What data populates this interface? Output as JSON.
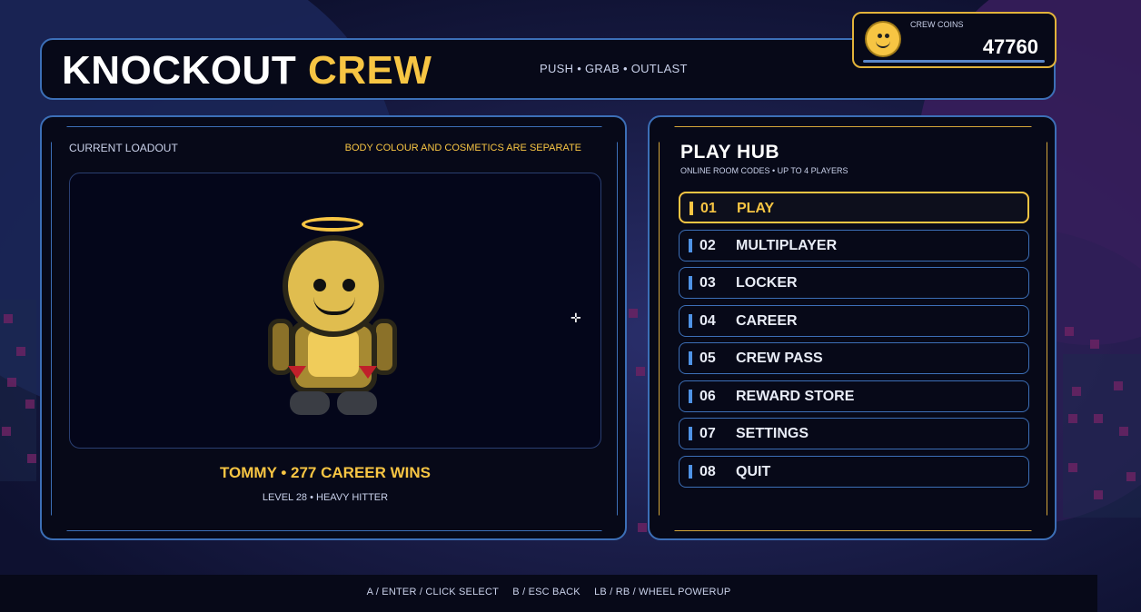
{
  "header": {
    "title_white": "KNOCKOUT",
    "title_yellow": "CREW",
    "tagline": "PUSH • GRAB • OUTLAST"
  },
  "coins": {
    "label": "CREW COINS",
    "value": "47760"
  },
  "loadout": {
    "label": "CURRENT LOADOUT",
    "note": "BODY COLOUR AND COSMETICS ARE SEPARATE",
    "player_line": "TOMMY  •  277 CAREER WINS",
    "player_sub": "LEVEL 28  •  HEAVY HITTER"
  },
  "hub": {
    "title": "PLAY HUB",
    "subtitle": "ONLINE ROOM CODES  •  UP TO 4 PLAYERS",
    "items": [
      {
        "num": "01",
        "label": "PLAY",
        "active": true
      },
      {
        "num": "02",
        "label": "MULTIPLAYER"
      },
      {
        "num": "03",
        "label": "LOCKER"
      },
      {
        "num": "04",
        "label": "CAREER"
      },
      {
        "num": "05",
        "label": "CREW PASS"
      },
      {
        "num": "06",
        "label": "REWARD STORE"
      },
      {
        "num": "07",
        "label": "SETTINGS"
      },
      {
        "num": "08",
        "label": "QUIT"
      }
    ]
  },
  "footer": {
    "hint_select": "A / ENTER / CLICK  SELECT",
    "hint_back": "B / ESC  BACK",
    "hint_powerup": "LB / RB / WHEEL  POWERUP"
  },
  "colors": {
    "accent_yellow": "#f7c543",
    "accent_blue": "#3c6fb7",
    "panel_bg": "#070918"
  }
}
